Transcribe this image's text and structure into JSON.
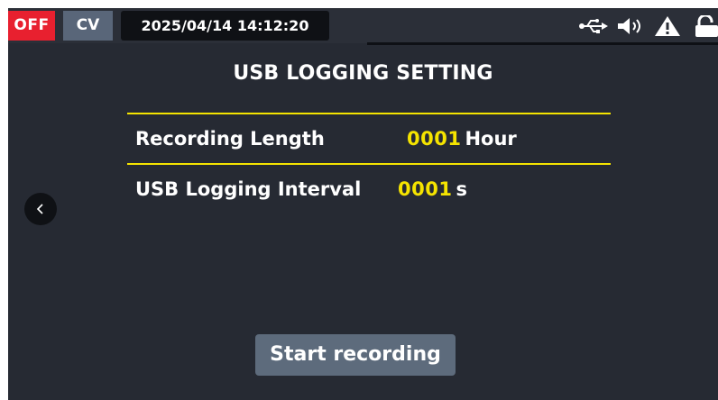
{
  "status_bar": {
    "output_state": "OFF",
    "mode": "CV",
    "datetime": "2025/04/14 14:12:20",
    "icons": [
      "usb-icon",
      "speaker-icon",
      "warning-icon",
      "lock-icon"
    ]
  },
  "page": {
    "title": "USB LOGGING SETTING"
  },
  "fields": {
    "recording_length": {
      "label": "Recording Length",
      "value": "0001",
      "unit": "Hour"
    },
    "logging_interval": {
      "label": "USB Logging Interval",
      "value": "0001",
      "unit": "s"
    }
  },
  "actions": {
    "start_recording": "Start recording",
    "back_icon": "chevron-left-icon"
  },
  "colors": {
    "background": "#262a33",
    "accent_yellow": "#f5e400",
    "off_red": "#e8202f",
    "mode_badge": "#596679",
    "button": "#5d6b7c"
  }
}
